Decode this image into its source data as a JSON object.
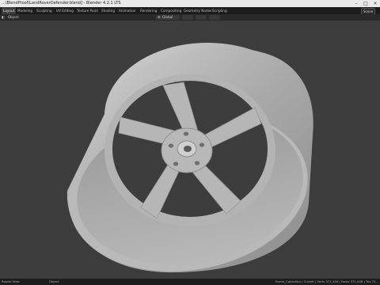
{
  "window": {
    "title": "...\\BlendProof\\LandRoverDefender.blend] - Blender 4.2.1 LTS",
    "min_icon": "minimize-icon",
    "max_icon": "maximize-icon",
    "close_icon": "close-icon"
  },
  "workspaces": [
    "Layout",
    "Modeling",
    "Sculpting",
    "UV Editing",
    "Texture Paint",
    "Shading",
    "Animation",
    "Rendering",
    "Compositing",
    "Geometry Nodes",
    "Scripting"
  ],
  "active_workspace": "Layout",
  "scene": {
    "name": "Scene"
  },
  "header": {
    "mode": "Object",
    "transform_orientation": "Global"
  },
  "statusbar": {
    "left_hint": "Rotate View",
    "center_hint": "Object",
    "stats": "Scene_Collection | Cricket | Verts 371,146 | Faces 371,008 | Tris 74..."
  },
  "colors": {
    "viewport_bg": "#3d3d3d",
    "model_light": "#c9c9c9",
    "model_mid": "#a8a8a8",
    "model_dark": "#8a8a8a",
    "menubar_bg": "#1d1d1d"
  }
}
